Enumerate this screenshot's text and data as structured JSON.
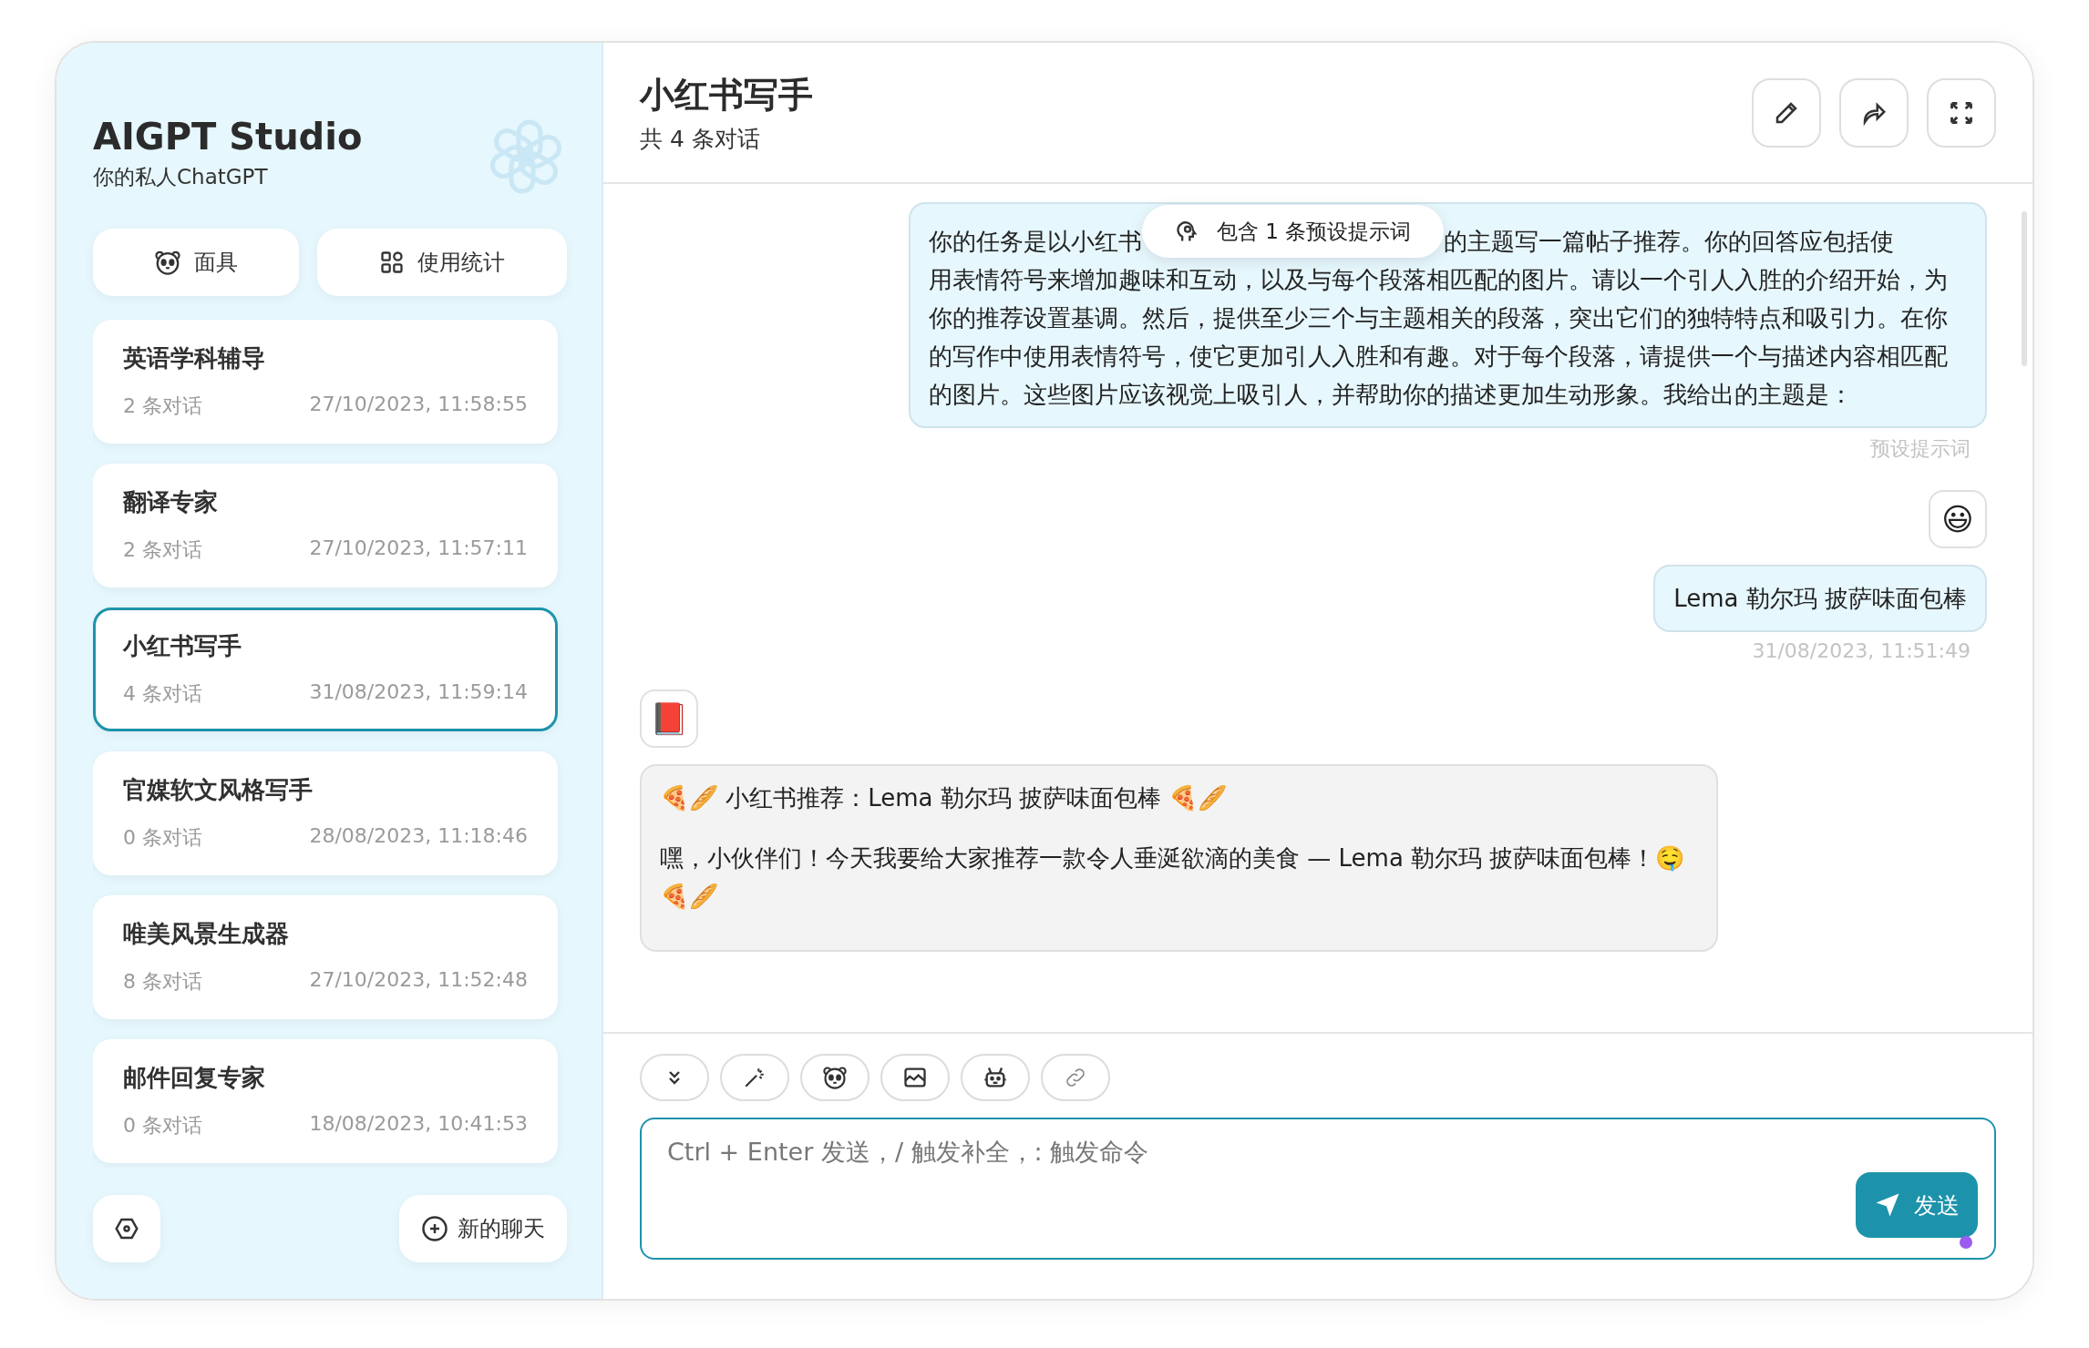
{
  "sidebar": {
    "title": "AIGPT Studio",
    "subtitle": "你的私人ChatGPT",
    "buttons": [
      {
        "kind": "mask",
        "label": "面具"
      },
      {
        "kind": "stats",
        "label": "使用统计"
      }
    ],
    "chats": [
      {
        "title": "英语学科辅导",
        "count": "2 条对话",
        "time": "27/10/2023, 11:58:55",
        "selected": false
      },
      {
        "title": "翻译专家",
        "count": "2 条对话",
        "time": "27/10/2023, 11:57:11",
        "selected": false
      },
      {
        "title": "小红书写手",
        "count": "4 条对话",
        "time": "31/08/2023, 11:59:14",
        "selected": true
      },
      {
        "title": "官媒软文风格写手",
        "count": "0 条对话",
        "time": "28/08/2023, 11:18:46",
        "selected": false
      },
      {
        "title": "唯美风景生成器",
        "count": "8 条对话",
        "time": "27/10/2023, 11:52:48",
        "selected": false
      },
      {
        "title": "邮件回复专家",
        "count": "0 条对话",
        "time": "18/08/2023, 10:41:53",
        "selected": false
      }
    ],
    "new_chat": "新的聊天"
  },
  "chat": {
    "title": "小红书写手",
    "subtitle": "共 4 条对话",
    "messages": [
      {
        "outgoing": true,
        "kind": "prompt",
        "text_before": "你的任务是以小红书",
        "badge": "包含 1 条预设提示词",
        "line_after": "的主题写一篇帖子推荐。你的回答应包括使",
        "text_after": "用表情符号来增加趣味和互动，以及与每个段落相匹配的图片。请以一个引人入胜的介绍开始，为你的推荐设置基调。然后，提供至少三个与主题相关的段落，突出它们的独特特点和吸引力。在你的写作中使用表情符号，使它更加引人入胜和有趣。对于每个段落，请提供一个与描述内容相匹配的图片。这些图片应该视觉上吸引人，并帮助你的描述更加生动形象。我给出的主题是：",
        "footer": "预设提示词"
      },
      {
        "outgoing": true,
        "kind": "text",
        "avatar": "😃",
        "text": "Lema 勒尔玛 披萨味面包棒",
        "footer": "31/08/2023, 11:51:49"
      },
      {
        "outgoing": false,
        "kind": "text",
        "avatar": "📕",
        "paragraphs": [
          "🍕🥖 小红书推荐：Lema 勒尔玛 披萨味面包棒 🍕🥖",
          "嘿，小伙伴们！今天我要给大家推荐一款令人垂涎欲滴的美食 — Lema 勒尔玛 披萨味面包棒！🤤🍕🥖"
        ]
      }
    ],
    "input": {
      "placeholder": "Ctrl + Enter 发送，/ 触发补全，: 触发命令",
      "send": "发送"
    }
  }
}
